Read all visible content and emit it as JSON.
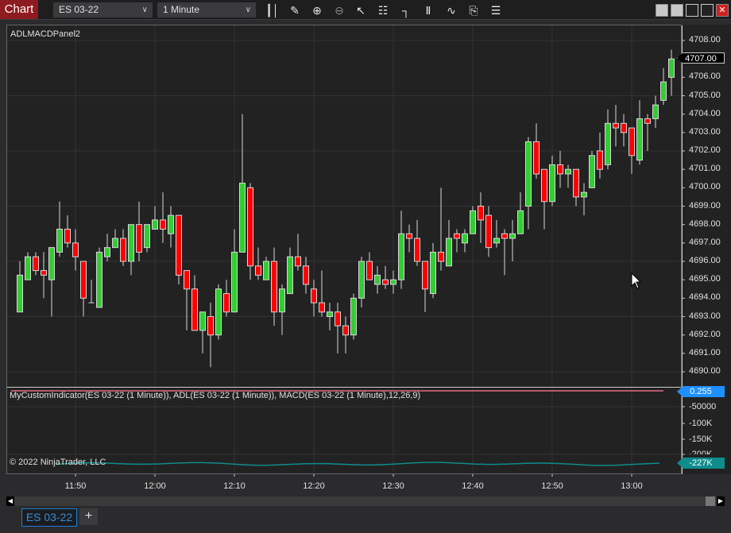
{
  "toolbar": {
    "chart_label": "Chart",
    "instrument": "ES 03-22",
    "interval": "1 Minute",
    "icons": [
      "bar-type-icon",
      "pencil-draw-icon",
      "zoom-in-icon",
      "zoom-out-icon",
      "pointer-icon",
      "data-box-icon",
      "chart-trader-icon",
      "indicators-icon",
      "strategies-icon",
      "templates-icon",
      "properties-icon"
    ]
  },
  "panel": {
    "title": "ADLMACDPanel2"
  },
  "indicator_panel": {
    "title": "MyCustomIndicator(ES 03-22 (1 Minute)), ADL(ES 03-22 (1 Minute)), MACD(ES 03-22 (1 Minute),12,26,9)",
    "macd_value": "0.255",
    "adl_value": "-227K",
    "axis_labels": [
      "-50000",
      "-100K",
      "-150K",
      "-200K"
    ],
    "copyright": "© 2022 NinjaTrader, LLC",
    "macd_color": "#b05a6a",
    "adl_color": "#0f8c8c"
  },
  "price_flag": "4707.00",
  "tab": {
    "label": "ES 03-22",
    "add": "+"
  },
  "colors": {
    "up": "#32cd32",
    "down": "#ff0000",
    "background": "#222222"
  },
  "chart_data": {
    "type": "candlestick",
    "title": "ES 03-22 1 Minute",
    "ylim": [
      4689.5,
      4708.5
    ],
    "yticks": [
      4690,
      4691,
      4692,
      4693,
      4694,
      4695,
      4696,
      4697,
      4698,
      4699,
      4700,
      4701,
      4702,
      4703,
      4704,
      4705,
      4706,
      4707,
      4708
    ],
    "ytick_labels": [
      "4690.00",
      "4691.00",
      "4692.00",
      "4693.00",
      "4694.00",
      "4695.00",
      "4696.00",
      "4697.00",
      "4698.00",
      "4699.00",
      "4700.00",
      "4701.00",
      "4702.00",
      "4703.00",
      "4704.00",
      "4705.00",
      "4706.00",
      "4707.00",
      "4708.00"
    ],
    "xtick_labels": [
      "11:50",
      "12:00",
      "12:10",
      "12:20",
      "12:30",
      "12:40",
      "12:50",
      "13:00"
    ],
    "first_bar": "11:43",
    "ohlc_fields": [
      "open",
      "high",
      "low",
      "close"
    ],
    "candles": [
      [
        4693.25,
        4696.0,
        4693.25,
        4695.25
      ],
      [
        4695.0,
        4696.5,
        4695.0,
        4696.25
      ],
      [
        4696.25,
        4696.5,
        4695.25,
        4695.5
      ],
      [
        4695.5,
        4696.5,
        4694.0,
        4695.25
      ],
      [
        4695.0,
        4696.75,
        4693.0,
        4696.75
      ],
      [
        4696.5,
        4699.25,
        4696.25,
        4697.75
      ],
      [
        4697.75,
        4698.5,
        4696.75,
        4697.0
      ],
      [
        4697.0,
        4697.75,
        4695.5,
        4696.25
      ],
      [
        4696.0,
        4696.0,
        4693.0,
        4694.0
      ],
      [
        4693.75,
        4695.0,
        4693.75,
        4693.75
      ],
      [
        4693.5,
        4696.75,
        4693.5,
        4696.5
      ],
      [
        4696.25,
        4697.5,
        4696.0,
        4696.75
      ],
      [
        4696.75,
        4697.75,
        4696.75,
        4697.25
      ],
      [
        4697.25,
        4697.75,
        4695.75,
        4696.0
      ],
      [
        4696.0,
        4698.0,
        4695.25,
        4698.0
      ],
      [
        4698.0,
        4699.25,
        4696.0,
        4696.5
      ],
      [
        4696.75,
        4698.0,
        4696.5,
        4698.0
      ],
      [
        4697.75,
        4699.0,
        4697.75,
        4698.25
      ],
      [
        4698.25,
        4699.75,
        4697.0,
        4697.75
      ],
      [
        4697.5,
        4699.0,
        4696.75,
        4698.5
      ],
      [
        4698.5,
        4698.5,
        4694.75,
        4695.25
      ],
      [
        4695.5,
        4695.5,
        4692.25,
        4694.5
      ],
      [
        4694.5,
        4695.25,
        4692.25,
        4692.25
      ],
      [
        4692.25,
        4693.25,
        4691.0,
        4693.25
      ],
      [
        4693.0,
        4693.75,
        4690.25,
        4692.0
      ],
      [
        4692.0,
        4694.75,
        4691.75,
        4694.5
      ],
      [
        4694.25,
        4695.0,
        4693.0,
        4693.25
      ],
      [
        4693.25,
        4697.75,
        4693.25,
        4696.5
      ],
      [
        4696.5,
        4704.0,
        4696.5,
        4700.25
      ],
      [
        4700.0,
        4700.25,
        4695.0,
        4695.75
      ],
      [
        4695.75,
        4696.75,
        4695.0,
        4695.25
      ],
      [
        4695.0,
        4696.25,
        4695.0,
        4696.0
      ],
      [
        4696.0,
        4696.75,
        4692.5,
        4693.25
      ],
      [
        4693.25,
        4694.75,
        4692.0,
        4694.5
      ],
      [
        4694.25,
        4696.75,
        4694.25,
        4696.25
      ],
      [
        4696.25,
        4697.5,
        4695.5,
        4695.75
      ],
      [
        4695.75,
        4696.25,
        4694.25,
        4694.75
      ],
      [
        4694.5,
        4695.0,
        4693.0,
        4693.75
      ],
      [
        4693.75,
        4695.5,
        4693.0,
        4693.25
      ],
      [
        4693.0,
        4693.75,
        4692.25,
        4693.25
      ],
      [
        4693.25,
        4693.75,
        4691.0,
        4692.5
      ],
      [
        4692.5,
        4693.0,
        4691.0,
        4692.0
      ],
      [
        4692.0,
        4694.25,
        4691.75,
        4694.0
      ],
      [
        4694.0,
        4696.25,
        4693.5,
        4696.0
      ],
      [
        4696.0,
        4696.5,
        4695.0,
        4695.0
      ],
      [
        4694.75,
        4695.75,
        4694.25,
        4695.25
      ],
      [
        4695.0,
        4695.75,
        4694.5,
        4694.75
      ],
      [
        4694.75,
        4695.5,
        4694.25,
        4695.0
      ],
      [
        4695.0,
        4698.75,
        4694.5,
        4697.5
      ],
      [
        4697.5,
        4698.0,
        4696.5,
        4697.25
      ],
      [
        4697.25,
        4698.25,
        4695.75,
        4696.0
      ],
      [
        4696.0,
        4696.0,
        4693.25,
        4694.5
      ],
      [
        4694.25,
        4697.0,
        4694.0,
        4696.5
      ],
      [
        4696.5,
        4700.0,
        4695.5,
        4696.0
      ],
      [
        4695.75,
        4698.25,
        4695.75,
        4697.25
      ],
      [
        4697.5,
        4697.75,
        4696.5,
        4697.25
      ],
      [
        4697.0,
        4697.75,
        4696.5,
        4697.5
      ],
      [
        4697.5,
        4699.0,
        4697.5,
        4698.75
      ],
      [
        4699.0,
        4699.75,
        4697.0,
        4698.25
      ],
      [
        4698.5,
        4699.0,
        4696.25,
        4696.75
      ],
      [
        4697.0,
        4698.25,
        4696.75,
        4697.25
      ],
      [
        4697.5,
        4697.75,
        4695.25,
        4697.25
      ],
      [
        4697.25,
        4698.25,
        4696.0,
        4697.5
      ],
      [
        4697.5,
        4699.75,
        4697.5,
        4698.75
      ],
      [
        4699.0,
        4702.75,
        4697.75,
        4702.5
      ],
      [
        4702.5,
        4703.5,
        4700.5,
        4700.75
      ],
      [
        4701.0,
        4701.0,
        4697.75,
        4699.25
      ],
      [
        4699.25,
        4701.75,
        4699.0,
        4701.25
      ],
      [
        4701.25,
        4702.0,
        4700.0,
        4700.75
      ],
      [
        4700.75,
        4701.25,
        4700.0,
        4701.0
      ],
      [
        4701.0,
        4701.0,
        4699.0,
        4699.5
      ],
      [
        4699.5,
        4700.25,
        4698.5,
        4699.75
      ],
      [
        4700.0,
        4702.0,
        4700.0,
        4701.75
      ],
      [
        4702.0,
        4703.0,
        4700.5,
        4701.0
      ],
      [
        4701.25,
        4704.25,
        4701.0,
        4703.5
      ],
      [
        4703.5,
        4704.5,
        4702.25,
        4703.25
      ],
      [
        4703.5,
        4704.0,
        4702.25,
        4703.0
      ],
      [
        4703.25,
        4703.25,
        4700.75,
        4701.75
      ],
      [
        4701.5,
        4704.75,
        4701.25,
        4703.75
      ],
      [
        4703.75,
        4704.0,
        4702.0,
        4703.5
      ],
      [
        4703.75,
        4705.0,
        4703.25,
        4704.5
      ],
      [
        4704.75,
        4706.5,
        4704.5,
        4705.75
      ],
      [
        4706.0,
        4707.5,
        4705.0,
        4707.0
      ]
    ]
  }
}
